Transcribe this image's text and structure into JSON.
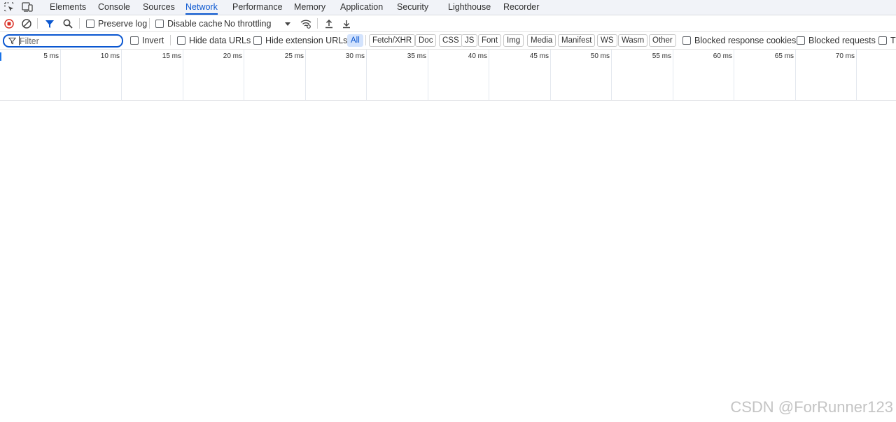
{
  "tabs": [
    {
      "label": "Elements"
    },
    {
      "label": "Console"
    },
    {
      "label": "Sources"
    },
    {
      "label": "Network",
      "active": true
    },
    {
      "label": "Performance"
    },
    {
      "label": "Memory"
    },
    {
      "label": "Application"
    },
    {
      "label": "Security"
    },
    {
      "label": "Lighthouse"
    },
    {
      "label": "Recorder"
    }
  ],
  "toolbar": {
    "preserve_log": "Preserve log",
    "disable_cache": "Disable cache",
    "throttling": "No throttling"
  },
  "filter": {
    "placeholder": "Filter",
    "invert": "Invert",
    "hide_data_urls": "Hide data URLs",
    "hide_extension_urls": "Hide extension URLs",
    "types": [
      "All",
      "Fetch/XHR",
      "Doc",
      "CSS",
      "JS",
      "Font",
      "Img",
      "Media",
      "Manifest",
      "WS",
      "Wasm",
      "Other"
    ],
    "active_type": "All",
    "blocked_response_cookies": "Blocked response cookies",
    "blocked_requests": "Blocked requests",
    "third_party": "Th"
  },
  "timeline": {
    "ticks": [
      "5 ms",
      "10 ms",
      "15 ms",
      "20 ms",
      "25 ms",
      "30 ms",
      "35 ms",
      "40 ms",
      "45 ms",
      "50 ms",
      "55 ms",
      "60 ms",
      "65 ms",
      "70 ms"
    ]
  },
  "watermark": "CSDN @ForRunner123",
  "colors": {
    "accent": "#0b57d0",
    "record": "#d93025"
  }
}
